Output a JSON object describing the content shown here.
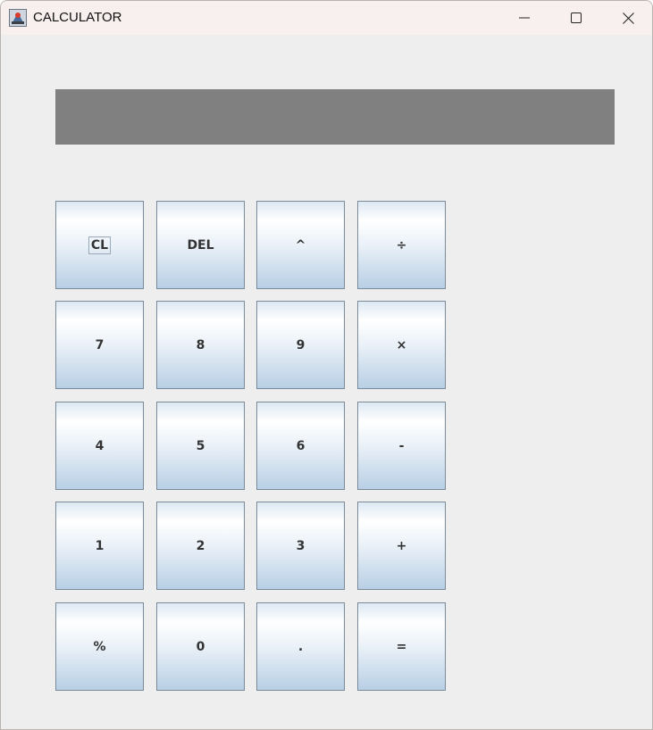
{
  "window": {
    "title": "CALCULATOR"
  },
  "display": {
    "value": ""
  },
  "keypad": {
    "keys": [
      "CL",
      "DEL",
      "^",
      "÷",
      "7",
      "8",
      "9",
      "×",
      "4",
      "5",
      "6",
      "-",
      "1",
      "2",
      "3",
      "+",
      "%",
      "0",
      ".",
      "="
    ]
  },
  "colors": {
    "titlebar": "#f8f0ee",
    "window_bg": "#eeeeee",
    "display_bg": "#808080",
    "key_text": "#333333"
  },
  "icons": [
    "app-icon",
    "minimize-icon",
    "maximize-icon",
    "close-icon"
  ]
}
